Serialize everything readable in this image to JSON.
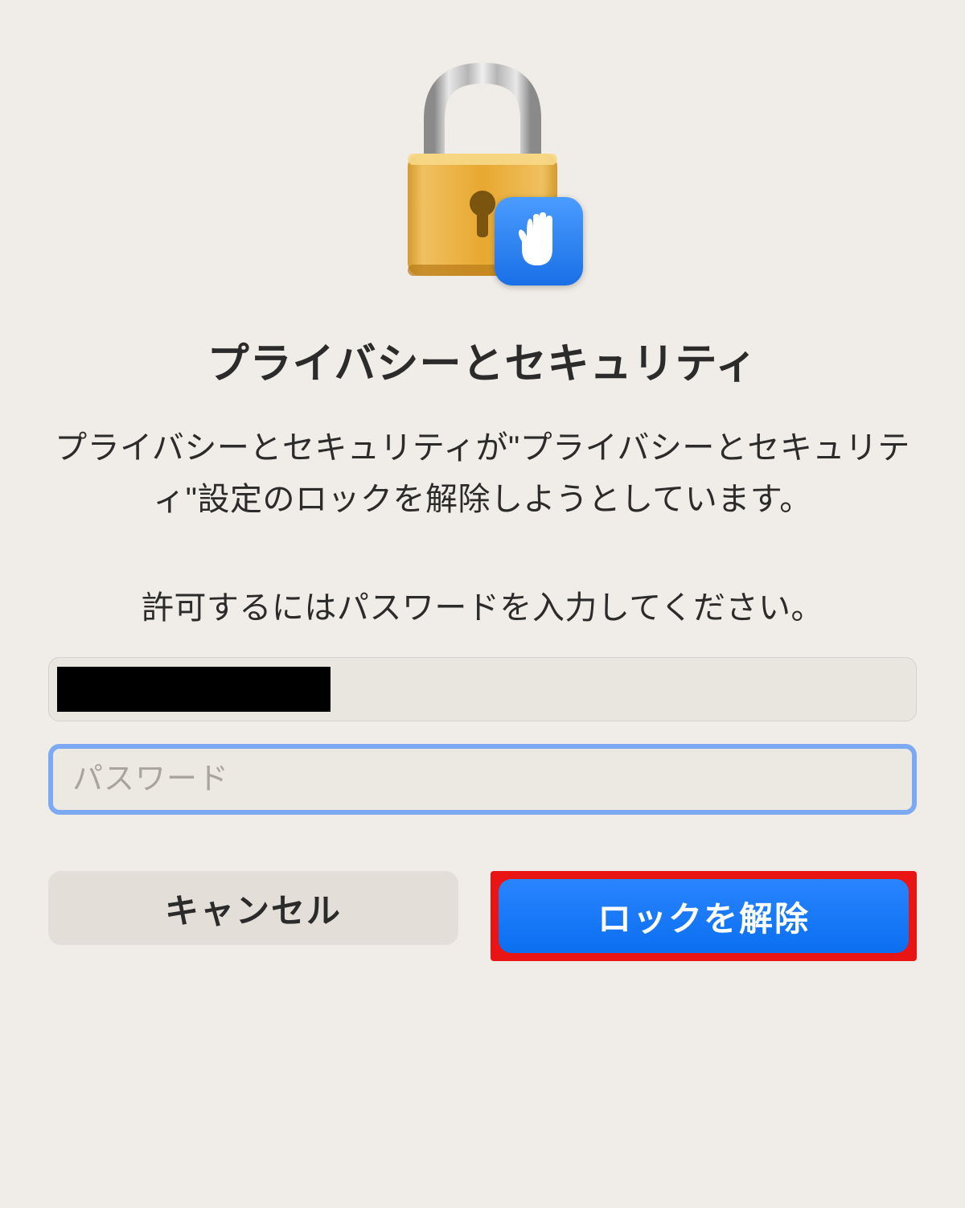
{
  "dialog": {
    "title": "プライバシーとセキュリティ",
    "message": "プライバシーとセキュリティが\"プライバシーとセキュリティ\"設定のロックを解除しようとしています。",
    "prompt": "許可するにはパスワードを入力してください。",
    "username_value": "",
    "password_placeholder": "パスワード",
    "password_value": "",
    "cancel_label": "キャンセル",
    "unlock_label": "ロックを解除"
  },
  "icons": {
    "main": "lock-icon",
    "badge": "hand-privacy-icon"
  },
  "colors": {
    "accent": "#0a6ff0",
    "highlight_border": "#e91414",
    "focus_ring": "#7da9f2",
    "background": "#f0ece7"
  }
}
